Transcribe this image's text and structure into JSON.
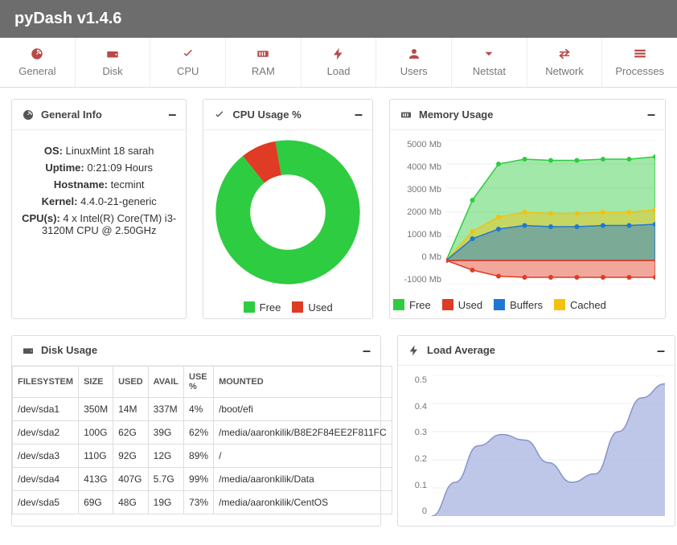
{
  "header": {
    "title": "pyDash v1.4.6"
  },
  "nav": [
    {
      "label": "General",
      "icon": "dashboard"
    },
    {
      "label": "Disk",
      "icon": "hdd"
    },
    {
      "label": "CPU",
      "icon": "check"
    },
    {
      "label": "RAM",
      "icon": "ram"
    },
    {
      "label": "Load",
      "icon": "bolt"
    },
    {
      "label": "Users",
      "icon": "user"
    },
    {
      "label": "Netstat",
      "icon": "chevron-down"
    },
    {
      "label": "Network",
      "icon": "transfer"
    },
    {
      "label": "Processes",
      "icon": "processes"
    }
  ],
  "general": {
    "title": "General Info",
    "os_k": "OS:",
    "os_v": "LinuxMint 18 sarah",
    "uptime_k": "Uptime:",
    "uptime_v": "0:21:09 Hours",
    "host_k": "Hostname:",
    "host_v": "tecmint",
    "kernel_k": "Kernel:",
    "kernel_v": "4.4.0-21-generic",
    "cpu_k": "CPU(s):",
    "cpu_v": "4 x Intel(R) Core(TM) i3-3120M CPU @ 2.50GHz"
  },
  "cpu_panel": {
    "title": "CPU Usage %",
    "legend": {
      "free": "Free",
      "used": "Used"
    }
  },
  "mem_panel": {
    "title": "Memory Usage",
    "ylabels": [
      "5000 Mb",
      "4000 Mb",
      "3000 Mb",
      "2000 Mb",
      "1000 Mb",
      "0 Mb",
      "-1000 Mb"
    ],
    "legend": {
      "free": "Free",
      "used": "Used",
      "buffers": "Buffers",
      "cached": "Cached"
    }
  },
  "disk_panel": {
    "title": "Disk Usage",
    "headers": [
      "FILESYSTEM",
      "SIZE",
      "USED",
      "AVAIL",
      "USE %",
      "MOUNTED"
    ],
    "rows": [
      [
        "/dev/sda1",
        "350M",
        "14M",
        "337M",
        "4%",
        "/boot/efi"
      ],
      [
        "/dev/sda2",
        "100G",
        "62G",
        "39G",
        "62%",
        "/media/aaronkilik/B8E2F84EE2F811FC"
      ],
      [
        "/dev/sda3",
        "110G",
        "92G",
        "12G",
        "89%",
        "/"
      ],
      [
        "/dev/sda4",
        "413G",
        "407G",
        "5.7G",
        "99%",
        "/media/aaronkilik/Data"
      ],
      [
        "/dev/sda5",
        "69G",
        "48G",
        "19G",
        "73%",
        "/media/aaronkilik/CentOS"
      ]
    ]
  },
  "load_panel": {
    "title": "Load Average",
    "ylabels": [
      "0.5",
      "0.4",
      "0.3",
      "0.2",
      "0.1",
      "0"
    ]
  },
  "colors": {
    "free": "#2ecc40",
    "used": "#e03b24",
    "buffers": "#1f77d4",
    "cached": "#f4c20d",
    "loadArea": "#aab4e0",
    "grid": "#e8e8e8"
  },
  "chart_data": {
    "cpu_donut": {
      "type": "pie",
      "series": [
        {
          "name": "Free",
          "value": 92,
          "color": "#2ecc40"
        },
        {
          "name": "Used",
          "value": 8,
          "color": "#e03b24"
        }
      ]
    },
    "memory": {
      "type": "area",
      "ylim": [
        -1000,
        5000
      ],
      "x": [
        0,
        1,
        2,
        3,
        4,
        5,
        6,
        7,
        8
      ],
      "series": [
        {
          "name": "Free",
          "color": "#2ecc40",
          "values": [
            0,
            2500,
            4000,
            4200,
            4150,
            4150,
            4200,
            4200,
            4300
          ]
        },
        {
          "name": "Cached",
          "color": "#f4c20d",
          "values": [
            0,
            1200,
            1800,
            2000,
            1950,
            1950,
            2000,
            2000,
            2100
          ]
        },
        {
          "name": "Buffers",
          "color": "#1f77d4",
          "values": [
            0,
            900,
            1300,
            1450,
            1400,
            1400,
            1450,
            1450,
            1500
          ]
        },
        {
          "name": "Used",
          "color": "#e03b24",
          "values": [
            0,
            -400,
            -650,
            -700,
            -700,
            -700,
            -700,
            -700,
            -700
          ]
        }
      ]
    },
    "load": {
      "type": "area",
      "ylim": [
        0,
        0.5
      ],
      "x": [
        0,
        1,
        2,
        3,
        4,
        5,
        6,
        7,
        8,
        9,
        10
      ],
      "values": [
        0,
        0.12,
        0.25,
        0.29,
        0.27,
        0.19,
        0.12,
        0.15,
        0.3,
        0.42,
        0.47
      ]
    }
  }
}
